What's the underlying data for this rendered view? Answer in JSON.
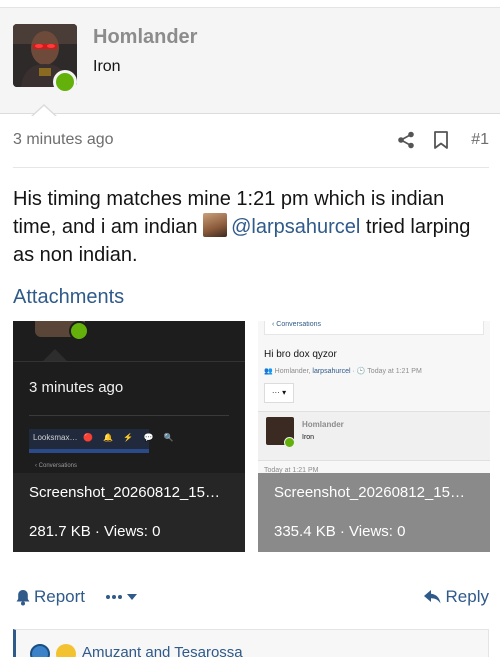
{
  "author": {
    "username": "Homlander",
    "title": "Iron",
    "online": true
  },
  "post": {
    "time": "3 minutes ago",
    "number": "#1",
    "body_part1": "His timing matches mine 1:21 pm which is indian time, and i am indian ",
    "mention": "@larpsahurcel",
    "body_part2": " tried larping as non indian."
  },
  "attachments": {
    "heading": "Attachments",
    "items": [
      {
        "name": "Screenshot_20260812_15…",
        "info": "281.7 KB · Views: 0",
        "thumb": {
          "time": "3 minutes ago",
          "nav_text": "Looksmax…",
          "sub_text": "‹ Conversations"
        }
      },
      {
        "name": "Screenshot_20260812_15…",
        "info": "335.4 KB · Views: 0",
        "thumb": {
          "breadcrumb": "‹  Conversations",
          "title": "Hi bro dox qyzor",
          "byline_prefix": "👥 Homlander, ",
          "byline_link": "larpsahurcel",
          "byline_suffix": " · 🕒 Today at 1:21 PM",
          "button": "··· ▾",
          "post_username": "Homlander",
          "post_title": "Iron",
          "time": "Today at 1:21 PM"
        }
      }
    ]
  },
  "actions": {
    "report": "Report",
    "reply": "Reply"
  },
  "reactions": {
    "text": "Amuzant and Tesarossa",
    "icons": [
      "thumbs-up-icon",
      "grin-emoji-icon"
    ]
  },
  "colors": {
    "accent": "#2f5a8a",
    "online": "#63b10a",
    "muted": "#8c8c8c"
  }
}
